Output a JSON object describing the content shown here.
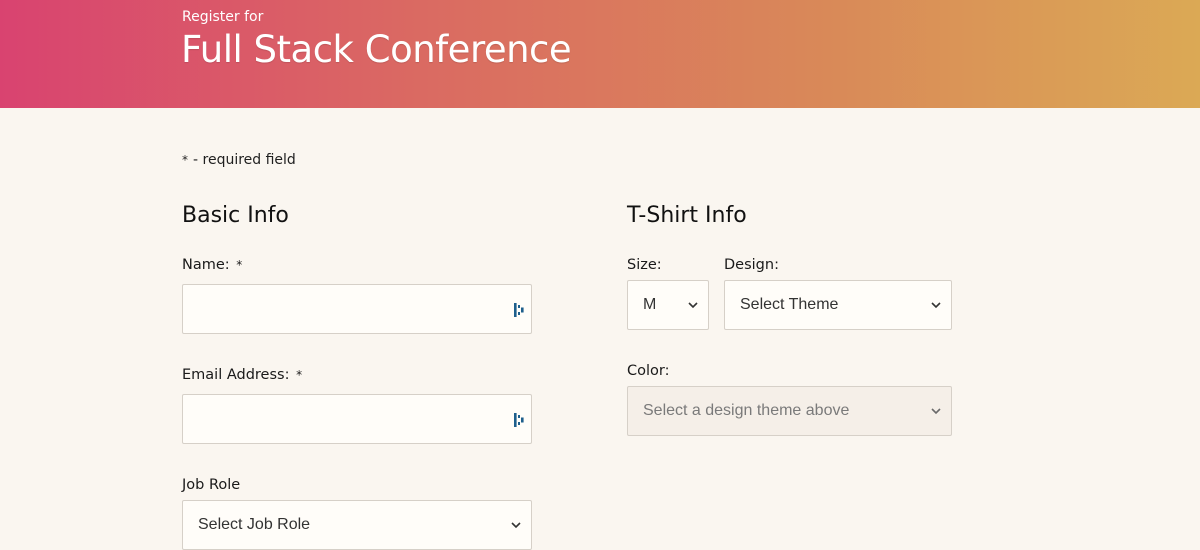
{
  "header": {
    "subtitle": "Register for",
    "title": "Full Stack Conference"
  },
  "required_note": {
    "star": "*",
    "text": "- required field"
  },
  "basic_info": {
    "heading": "Basic Info",
    "name_label": "Name:",
    "name_value": "",
    "email_label": "Email Address:",
    "email_value": "",
    "required_star": "*",
    "job_role_label": "Job Role",
    "job_role_selected": "Select Job Role"
  },
  "tshirt_info": {
    "heading": "T-Shirt Info",
    "size_label": "Size:",
    "size_selected": "M",
    "design_label": "Design:",
    "design_selected": "Select Theme",
    "color_label": "Color:",
    "color_selected": "Select a design theme above"
  },
  "icons": {
    "password_manager": "password-manager-icon",
    "dropdown": "chevron-down-icon"
  },
  "colors": {
    "gradient_start": "#d94370",
    "gradient_end": "#dba955",
    "background": "#faf6f0",
    "input_border": "#d6d0c8",
    "pw_icon": "#1e5f8c"
  }
}
